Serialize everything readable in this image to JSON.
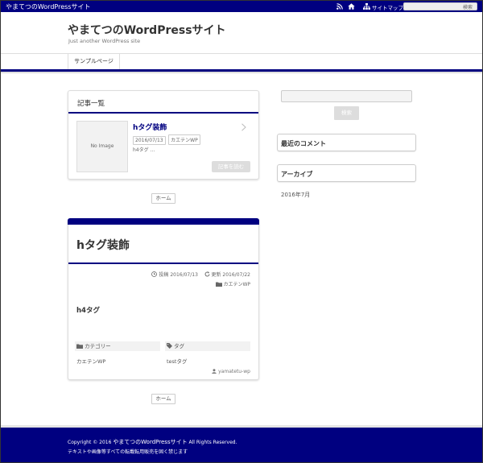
{
  "topbar": {
    "site_title": "やまてつのWordPressサイト",
    "sitemap_label": "サイトマップ",
    "search_placeholder": "",
    "search_button": "検索"
  },
  "header": {
    "title": "やまてつのWordPressサイト",
    "tagline": "Just another WordPress site"
  },
  "nav": {
    "items": [
      {
        "label": "サンプルページ"
      }
    ]
  },
  "article_list": {
    "heading": "記事一覧",
    "entries": [
      {
        "thumbnail_label": "No Image",
        "title": "hタグ装飾",
        "date": "2016/07/13",
        "category": "カエテンWP",
        "excerpt": "h4タグ ...",
        "read_more": "記事を読む"
      }
    ],
    "home_button": "ホーム"
  },
  "post": {
    "title": "hタグ装飾",
    "posted_label": "投稿",
    "posted_date": "2016/07/13",
    "updated_label": "更新",
    "updated_date": "2016/07/22",
    "category": "カエテンWP",
    "body_heading": "h4タグ",
    "category_label": "カテゴリー",
    "category_value": "カエテンWP",
    "tag_label": "タグ",
    "tag_value": "testタグ",
    "author": "yamatetu-wp",
    "home_button": "ホーム"
  },
  "sidebar": {
    "search_placeholder": "",
    "search_button": "検索",
    "recent_comments_title": "最近のコメント",
    "archives_title": "アーカイブ",
    "archives": [
      "2016年7月"
    ]
  },
  "footer": {
    "copyright_prefix": "Copyright © 2016 ",
    "copyright_site": "やまてつのWordPressサイト",
    "copyright_suffix": " All Rights Reserved.",
    "notice": "テキストや画像等すべての転載転用販売を固く禁じます"
  },
  "colors": {
    "accent": "#000080",
    "button_disabled": "#dddddd"
  }
}
